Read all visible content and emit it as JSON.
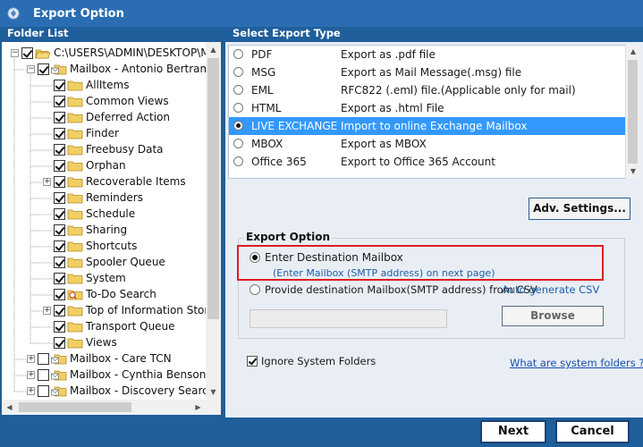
{
  "window": {
    "title": "Export Option"
  },
  "folder_list": {
    "header": "Folder List",
    "items": [
      {
        "label": "C:\\USERS\\ADMIN\\DESKTOP\\MA",
        "level": 0,
        "expander": "-",
        "checked": true,
        "folder": "open"
      },
      {
        "label": "Mailbox - Antonio Bertram",
        "level": 1,
        "expander": "-",
        "checked": true,
        "folder": "mailbox"
      },
      {
        "label": "AllItems",
        "level": 2,
        "expander": "",
        "checked": true,
        "folder": "plain"
      },
      {
        "label": "Common Views",
        "level": 2,
        "expander": "",
        "checked": true,
        "folder": "plain"
      },
      {
        "label": "Deferred Action",
        "level": 2,
        "expander": "",
        "checked": true,
        "folder": "plain"
      },
      {
        "label": "Finder",
        "level": 2,
        "expander": "",
        "checked": true,
        "folder": "plain"
      },
      {
        "label": "Freebusy Data",
        "level": 2,
        "expander": "",
        "checked": true,
        "folder": "plain"
      },
      {
        "label": "Orphan",
        "level": 2,
        "expander": "",
        "checked": true,
        "folder": "plain"
      },
      {
        "label": "Recoverable Items",
        "level": 2,
        "expander": "+",
        "checked": true,
        "folder": "plain"
      },
      {
        "label": "Reminders",
        "level": 2,
        "expander": "",
        "checked": true,
        "folder": "plain"
      },
      {
        "label": "Schedule",
        "level": 2,
        "expander": "",
        "checked": true,
        "folder": "plain"
      },
      {
        "label": "Sharing",
        "level": 2,
        "expander": "",
        "checked": true,
        "folder": "plain"
      },
      {
        "label": "Shortcuts",
        "level": 2,
        "expander": "",
        "checked": true,
        "folder": "plain"
      },
      {
        "label": "Spooler Queue",
        "level": 2,
        "expander": "",
        "checked": true,
        "folder": "plain"
      },
      {
        "label": "System",
        "level": 2,
        "expander": "",
        "checked": true,
        "folder": "plain"
      },
      {
        "label": "To-Do Search",
        "level": 2,
        "expander": "",
        "checked": true,
        "folder": "search"
      },
      {
        "label": "Top of Information Store",
        "level": 2,
        "expander": "+",
        "checked": true,
        "folder": "plain"
      },
      {
        "label": "Transport Queue",
        "level": 2,
        "expander": "",
        "checked": true,
        "folder": "plain"
      },
      {
        "label": "Views",
        "level": 2,
        "expander": "",
        "checked": true,
        "folder": "plain"
      },
      {
        "label": "Mailbox - Care TCN",
        "level": 1,
        "expander": "+",
        "checked": false,
        "folder": "mailbox"
      },
      {
        "label": "Mailbox - Cynthia Benson",
        "level": 1,
        "expander": "+",
        "checked": false,
        "folder": "mailbox"
      },
      {
        "label": "Mailbox - Discovery Search M",
        "level": 1,
        "expander": "+",
        "checked": false,
        "folder": "mailbox"
      }
    ]
  },
  "export_types": {
    "header": "Select Export Type",
    "items": [
      {
        "name": "PDF",
        "description": "Export as .pdf file",
        "selected": false
      },
      {
        "name": "MSG",
        "description": "Export as Mail Message(.msg) file",
        "selected": false
      },
      {
        "name": "EML",
        "description": "RFC822 (.eml) file.(Applicable only for mail)",
        "selected": false
      },
      {
        "name": "HTML",
        "description": "Export as .html File",
        "selected": false
      },
      {
        "name": "LIVE EXCHANGE",
        "description": "Import to online Exchange Mailbox",
        "selected": true
      },
      {
        "name": "MBOX",
        "description": "Export as MBOX",
        "selected": false
      },
      {
        "name": "Office 365",
        "description": "Export to Office 365 Account",
        "selected": false
      }
    ]
  },
  "adv_settings_label": "Adv. Settings...",
  "export_option": {
    "title": "Export Option",
    "enter_destination_label": "Enter Destination Mailbox",
    "enter_destination_hint": "(Enter Mailbox (SMTP address) on next page)",
    "provide_csv_label": "Provide destination Mailbox(SMTP address) from CSV",
    "auto_generate_csv_label": "Auto generate CSV",
    "csv_path_value": "",
    "browse_label": "Browse",
    "selected": "enter_destination"
  },
  "ignore_system_folders": {
    "label": "Ignore System Folders",
    "checked": true
  },
  "system_folders_link": "What are system folders ?",
  "footer": {
    "next_label": "Next",
    "cancel_label": "Cancel"
  },
  "colors": {
    "window_blue": "#1f5f9b",
    "title_blue": "#2b6db3",
    "selection_blue": "#3399ff",
    "highlight_red": "#e01b24"
  }
}
